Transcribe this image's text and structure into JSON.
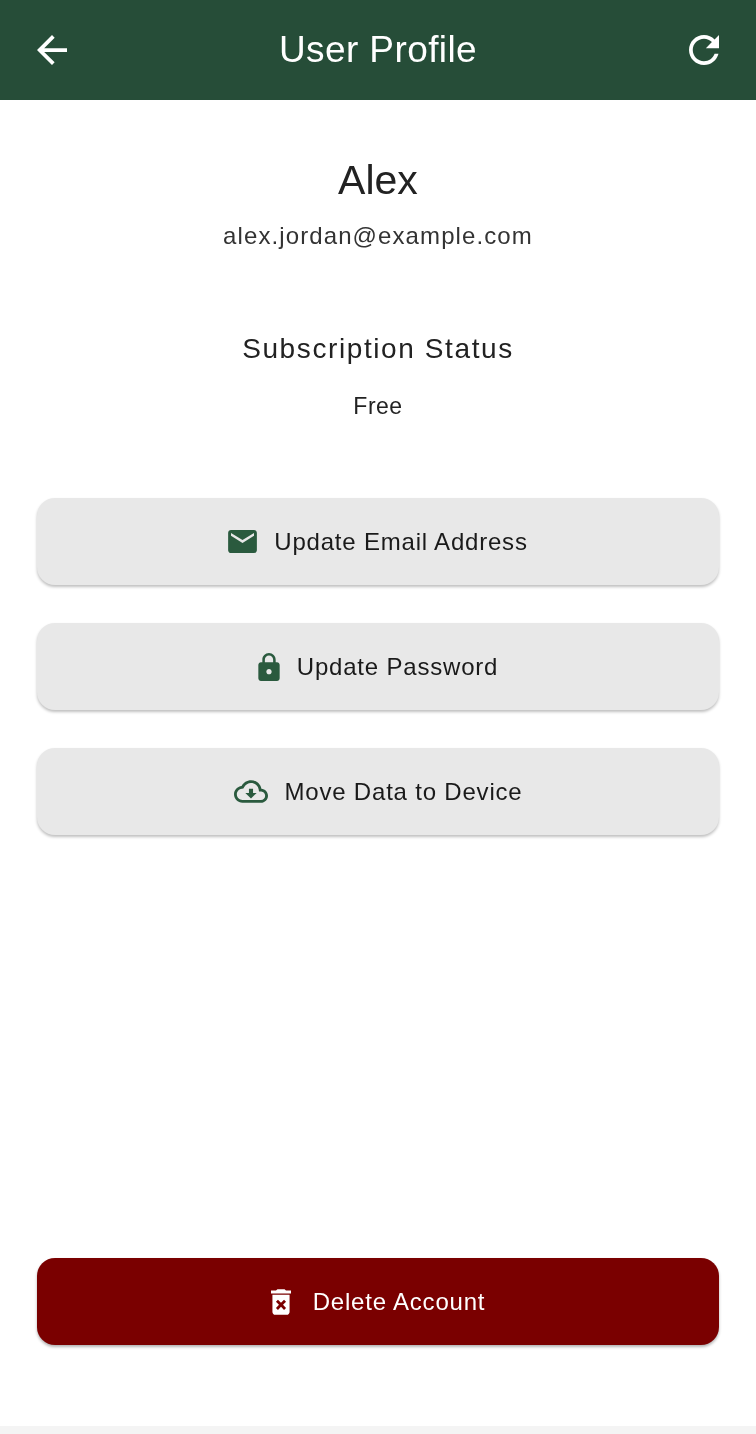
{
  "app_bar": {
    "title": "User Profile"
  },
  "profile": {
    "name": "Alex",
    "email": "alex.jordan@example.com"
  },
  "subscription": {
    "label": "Subscription Status",
    "value": "Free"
  },
  "actions": [
    {
      "kind": "email",
      "label": "Update Email Address"
    },
    {
      "kind": "password",
      "label": "Update Password"
    },
    {
      "kind": "transfer",
      "label": "Move Data to Device"
    }
  ],
  "delete_button": {
    "label": "Delete Account"
  }
}
